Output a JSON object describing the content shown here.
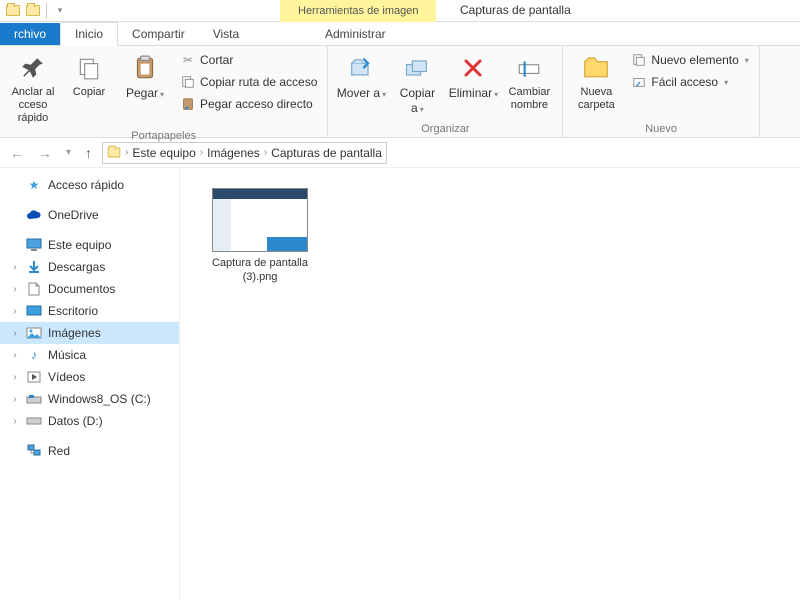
{
  "window": {
    "contextual_tools": "Herramientas de imagen",
    "title": "Capturas de pantalla"
  },
  "tabs": {
    "file": "rchivo",
    "home": "Inicio",
    "share": "Compartir",
    "view": "Vista",
    "manage": "Administrar"
  },
  "ribbon": {
    "clipboard": {
      "pin": "Anclar al cceso rápido",
      "copy": "Copiar",
      "paste": "Pegar",
      "cut": "Cortar",
      "copy_path": "Copiar ruta de acceso",
      "paste_shortcut": "Pegar acceso directo",
      "group": "Portapapeles"
    },
    "organize": {
      "move": "Mover a",
      "copy_to": "Copiar a",
      "delete": "Eliminar",
      "rename": "Cambiar nombre",
      "group": "Organizar"
    },
    "new": {
      "folder": "Nueva carpeta",
      "item": "Nuevo elemento",
      "easy": "Fácil acceso",
      "group": "Nuevo"
    }
  },
  "breadcrumb": {
    "root": "Este equipo",
    "p1": "Imágenes",
    "p2": "Capturas de pantalla"
  },
  "nav": {
    "quick": "Acceso rápido",
    "onedrive": "OneDrive",
    "thispc": "Este equipo",
    "downloads": "Descargas",
    "documents": "Documentos",
    "desktop": "Escritorio",
    "pictures": "Imágenes",
    "music": "Música",
    "videos": "Vídeos",
    "osdrive": "Windows8_OS (C:)",
    "datadrive": "Datos (D:)",
    "network": "Red"
  },
  "file": {
    "name": "Captura de pantalla (3).png"
  }
}
